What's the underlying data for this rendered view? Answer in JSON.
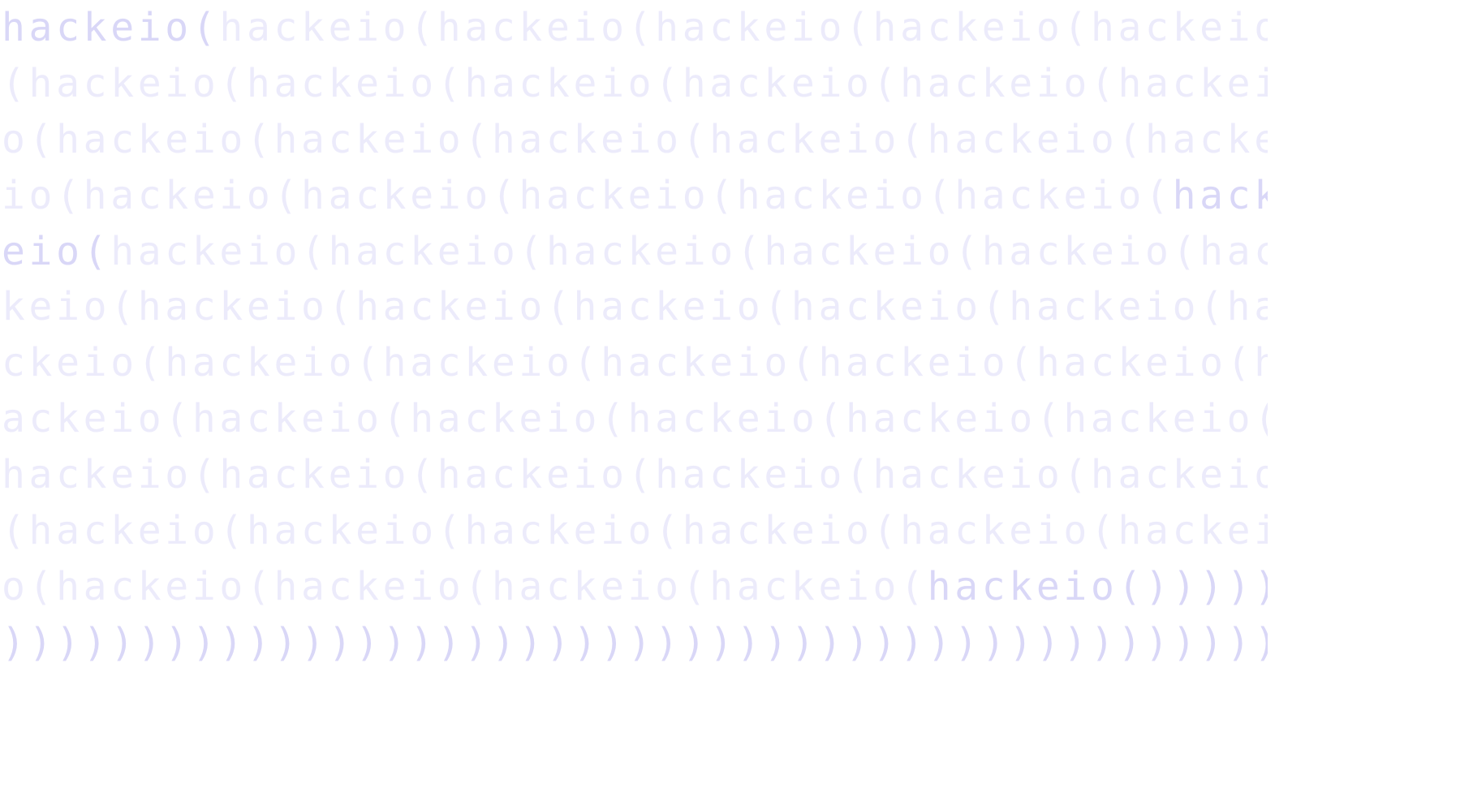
{
  "lines": [
    [
      {
        "t": "hackeio(",
        "hl": true
      },
      {
        "t": "hackeio(hackeio(hackeio(hackeio(hackeio",
        "hl": false
      }
    ],
    [
      {
        "t": "(hackeio(hackeio(hackeio(hackeio(hackeio(hackei",
        "hl": false
      }
    ],
    [
      {
        "t": "o(hackeio(hackeio(hackeio(hackeio(hackeio(hacke",
        "hl": false
      }
    ],
    [
      {
        "t": "io(hackeio(hackeio(hackeio(hackeio(hackeio(",
        "hl": false
      },
      {
        "t": "hack",
        "hl": true
      }
    ],
    [
      {
        "t": "eio(",
        "hl": true
      },
      {
        "t": "hackeio(hackeio(hackeio(hackeio(hackeio(hac",
        "hl": false
      }
    ],
    [
      {
        "t": "keio(hackeio(hackeio(hackeio(hackeio(hackeio(ha",
        "hl": false
      }
    ],
    [
      {
        "t": "ckeio(hackeio(hackeio(hackeio(hackeio(hackeio(h",
        "hl": false
      }
    ],
    [
      {
        "t": "ackeio(hackeio(hackeio(hackeio(hackeio(hackeio(",
        "hl": false
      }
    ],
    [
      {
        "t": "hackeio(hackeio(hackeio(hackeio(hackeio(hackeio",
        "hl": false
      }
    ],
    [
      {
        "t": "(hackeio(hackeio(hackeio(hackeio(hackeio(hackei",
        "hl": false
      }
    ],
    [
      {
        "t": "o(hackeio(hackeio(hackeio(hackeio(",
        "hl": false
      },
      {
        "t": "hackeio())))))))))))",
        "hl": true
      }
    ],
    [
      {
        "t": "))))))))))))))))))))))))))))))))))))))))))))))))",
        "hl": true
      }
    ]
  ]
}
